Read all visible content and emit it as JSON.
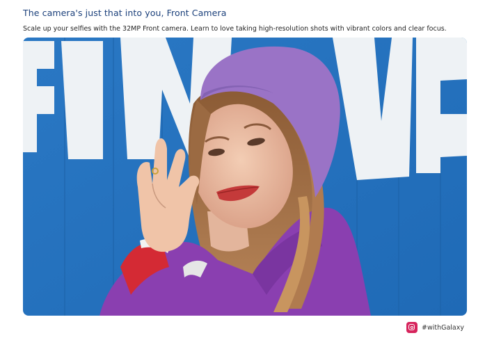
{
  "section": {
    "title": "The camera's just that into you, Front Camera",
    "subtitle": "Scale up your selfies with the 32MP Front camera. Learn to love taking high-resolution shots with vibrant colors and clear focus."
  },
  "photo": {
    "subject": "selfie-photo",
    "background_color": "#2f7fc8",
    "sweater_color": "#8a3fb0",
    "beret_color": "#9a73c6"
  },
  "social": {
    "icon": "instagram-icon",
    "hashtag": "#withGalaxy",
    "accent": "#d6245c"
  }
}
